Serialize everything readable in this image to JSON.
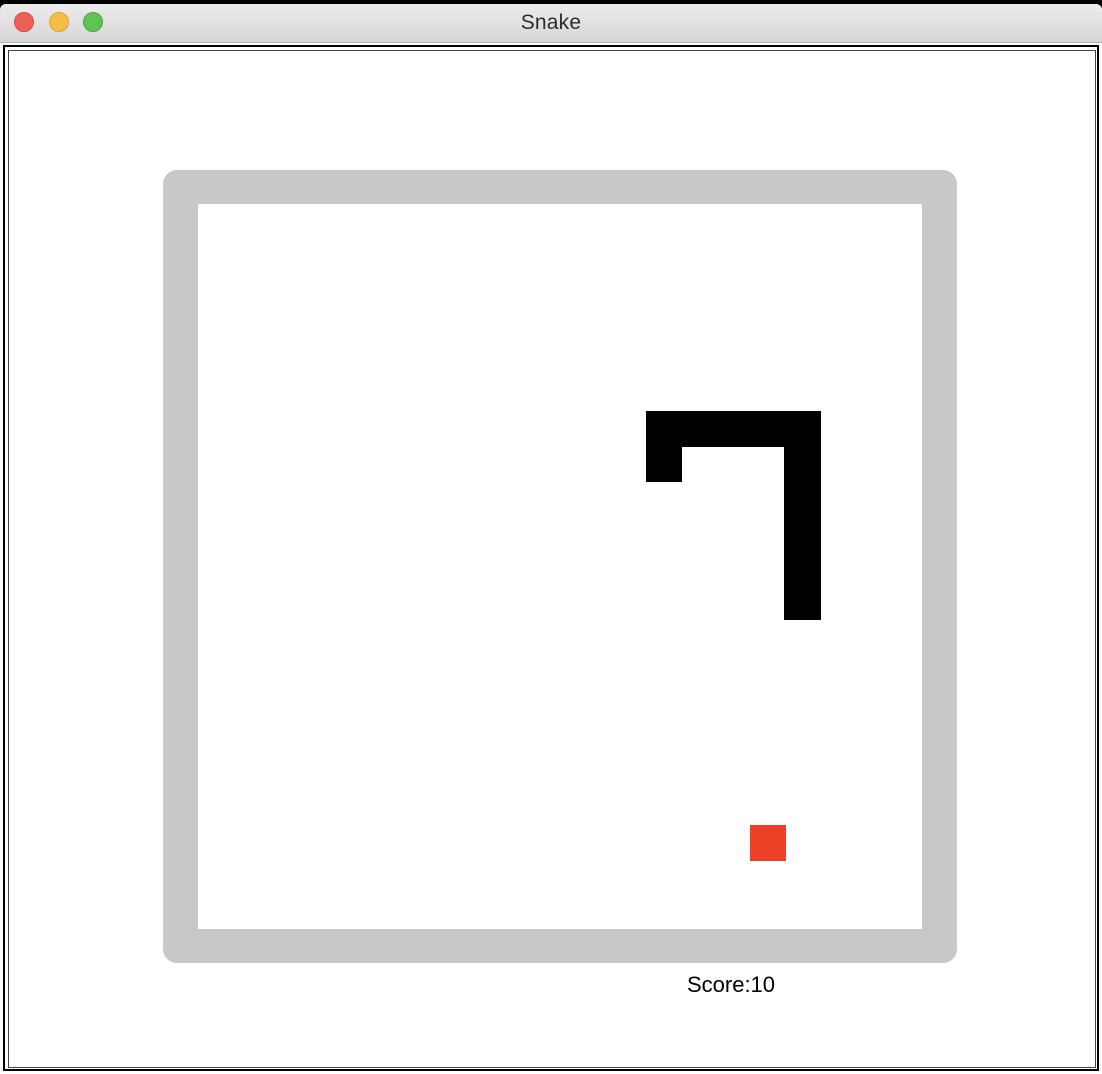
{
  "window": {
    "title": "Snake",
    "buttons": [
      "close",
      "minimize",
      "maximize"
    ]
  },
  "game": {
    "score_text": "Score:10",
    "snake_color": "#000000",
    "food_color": "#ec4127",
    "wall_color": "#c8c8c8",
    "field_color": "#ffffff"
  }
}
